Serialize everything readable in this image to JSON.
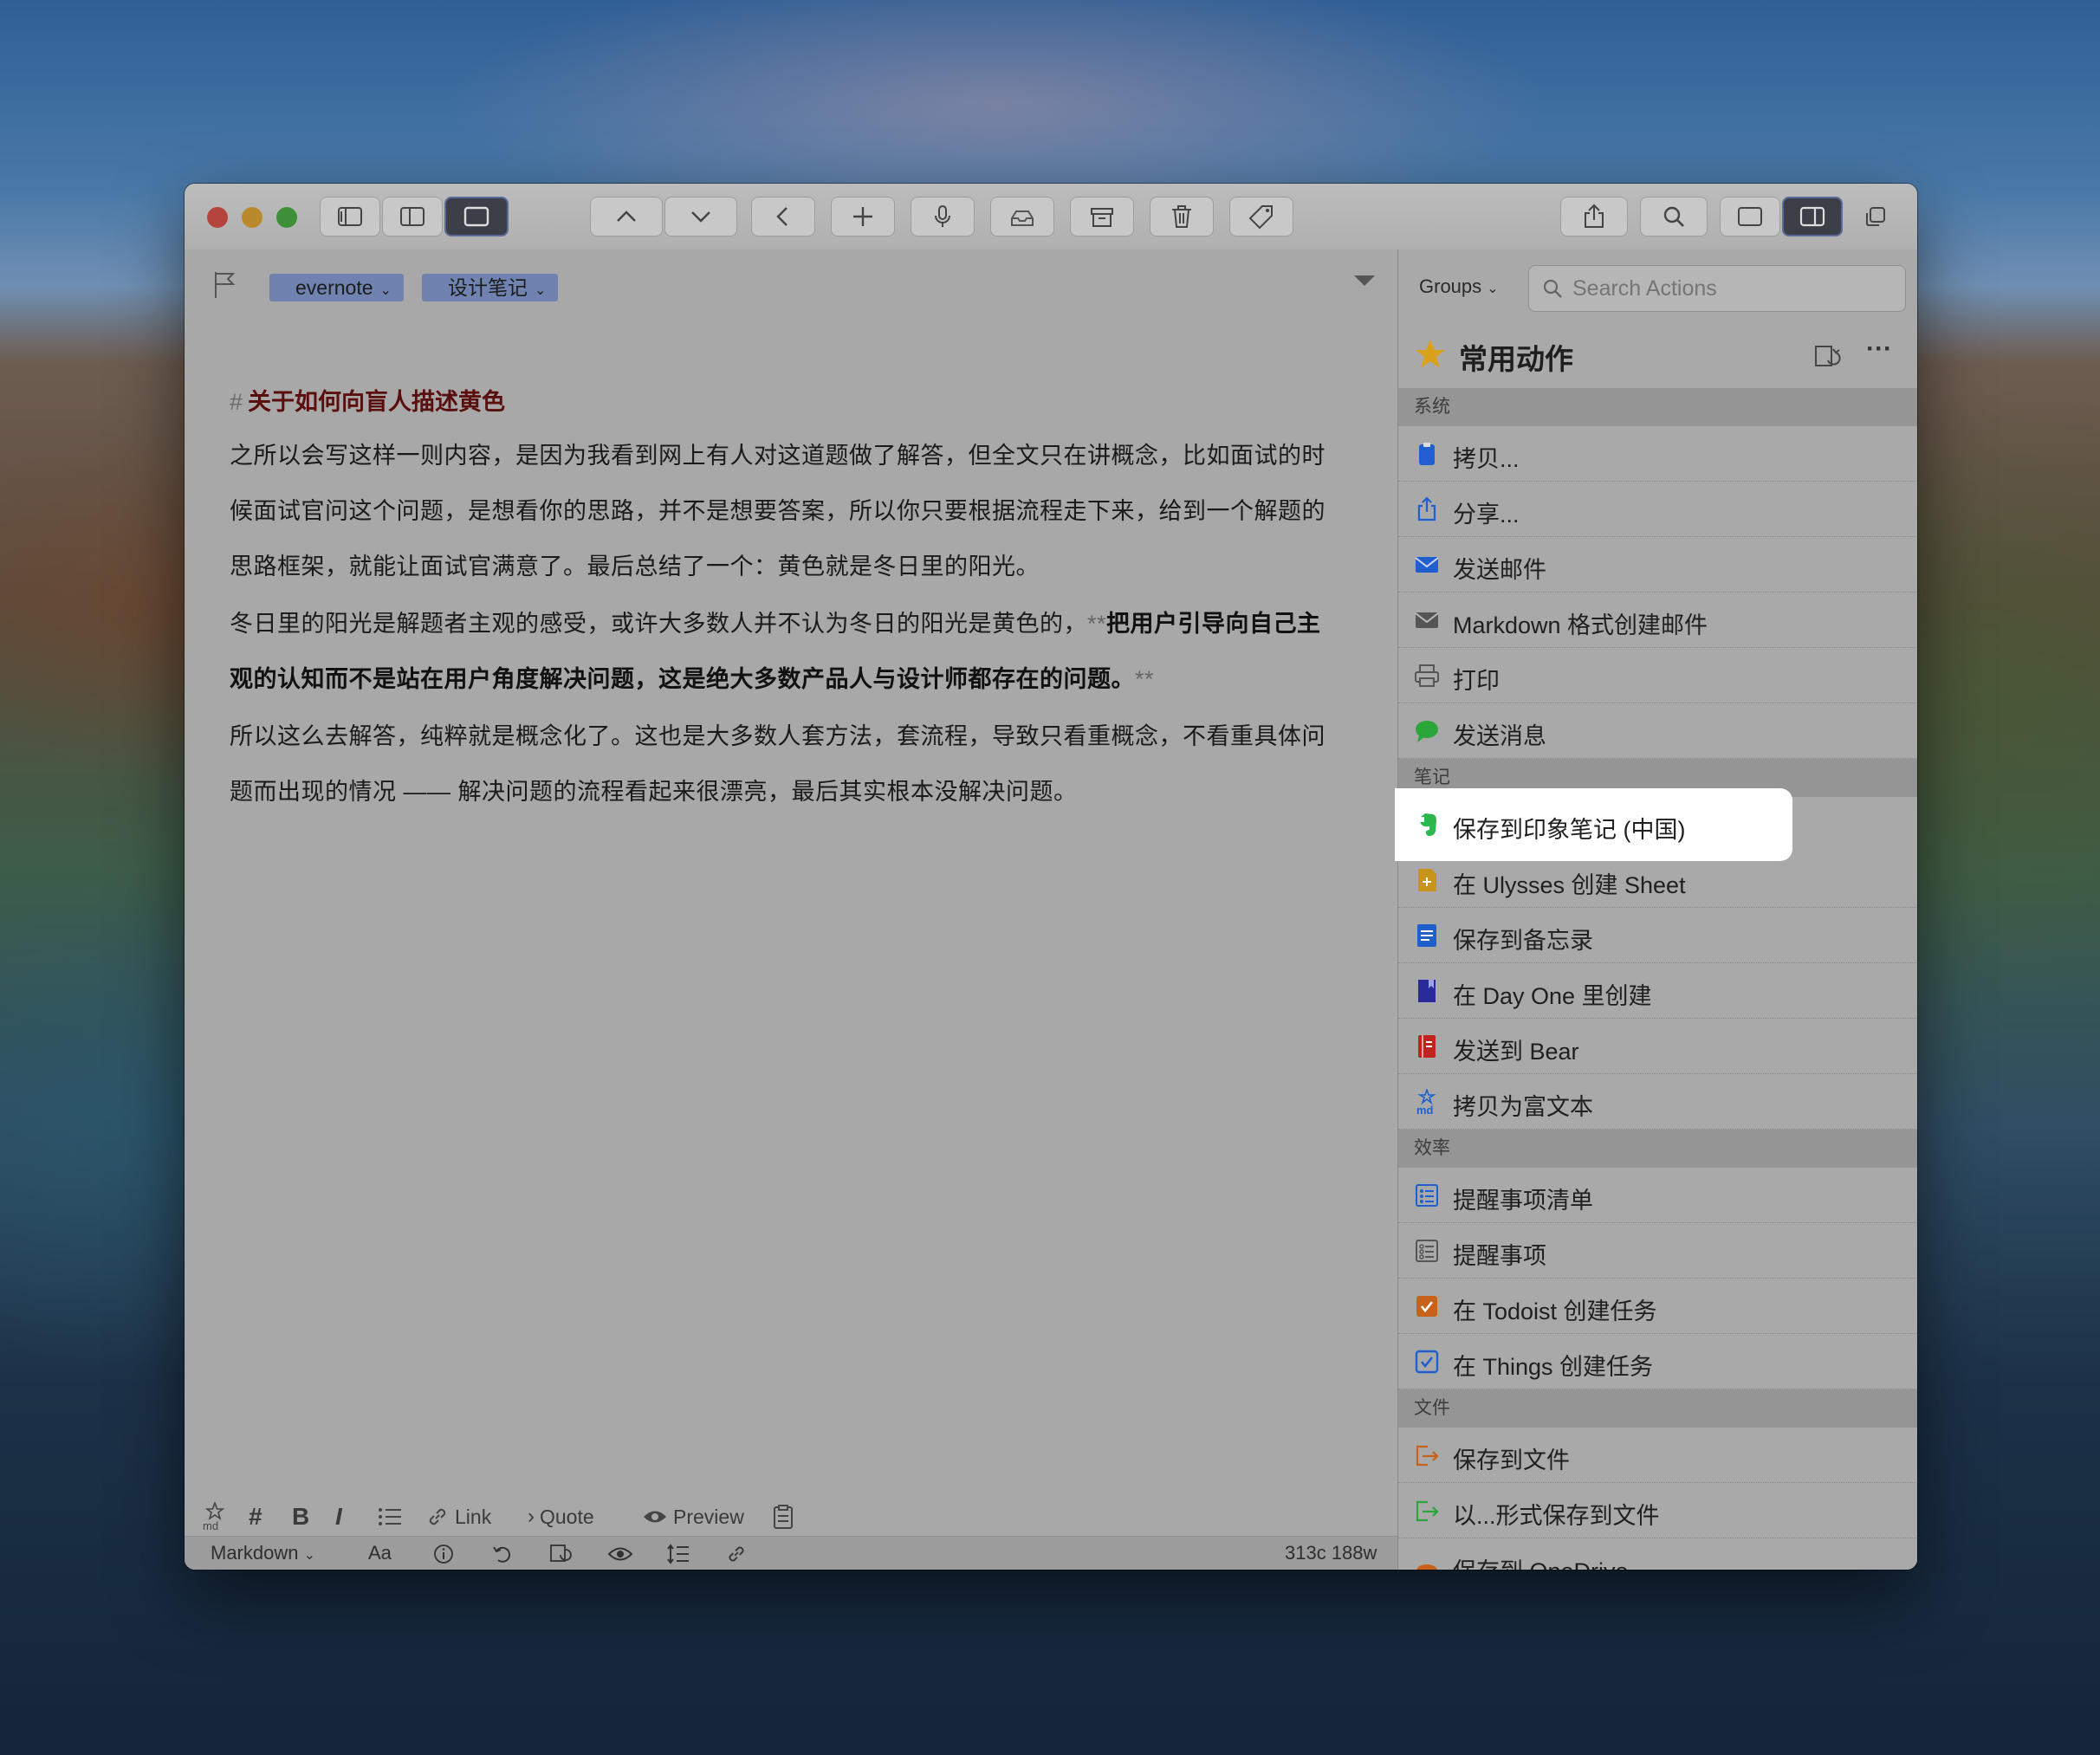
{
  "editor": {
    "tags": [
      "evernote",
      "设计笔记"
    ],
    "heading_mark": "#",
    "heading": "关于如何向盲人描述黄色",
    "para1_line1": "之所以会写这样一则内容，是因为我看到网上有人对这道题做了解答，但全文只在讲概念，比如面试的时",
    "para1_line2": "候面试官问这个问题，是想看你的思路，并不是想要答案，所以你只要根据流程走下来，给到一个解题的",
    "para1_line3": "思路框架，就能让面试官满意了。最后总结了一个：黄色就是冬日里的阳光。",
    "para2_line1_plain": "冬日里的阳光是解题者主观的感受，或许大多数人并不认为冬日的阳光是黄色的，",
    "para2_mark_open": "**",
    "para2_line1_bold": "把用户引导向自己主",
    "para2_line2_bold": "观的认知而不是站在用户角度解决问题，这是绝大多数产品人与设计师都存在的问题。",
    "para2_mark_close": "**",
    "para3_line1": "所以这么去解答，纯粹就是概念化了。这也是大多数人套方法，套流程，导致只看重概念，不看重具体问",
    "para3_line2": "题而出现的情况 —— 解决问题的流程看起来很漂亮，最后其实根本没解决问题。"
  },
  "format_bar": {
    "link": "Link",
    "quote": "Quote",
    "preview": "Preview"
  },
  "status_bar": {
    "mode": "Markdown",
    "font_size": "Aa",
    "count": "313c 188w"
  },
  "panel": {
    "groups_label": "Groups",
    "search_placeholder": "Search Actions",
    "title": "常用动作",
    "sections": [
      {
        "name": "系统",
        "items": [
          {
            "label": "拷贝...",
            "icon": "clipboard-icon",
            "color": "#1f5fd0"
          },
          {
            "label": "分享...",
            "icon": "share-icon",
            "color": "#1f5fd0"
          },
          {
            "label": "发送邮件",
            "icon": "mail-icon",
            "color": "#1f5fd0"
          },
          {
            "label": "Markdown 格式创建邮件",
            "icon": "mail-gray-icon",
            "color": "#555555"
          },
          {
            "label": "打印",
            "icon": "printer-icon",
            "color": "#555555"
          },
          {
            "label": "发送消息",
            "icon": "message-icon",
            "color": "#2aa63a"
          }
        ]
      },
      {
        "name": "笔记",
        "items": [
          {
            "label": "保存到印象笔记 (中国)",
            "icon": "evernote-icon",
            "color": "#2db84d"
          },
          {
            "label": "在 Ulysses 创建 Sheet",
            "icon": "ulysses-icon",
            "color": "#c8941a"
          },
          {
            "label": "保存到备忘录",
            "icon": "notes-icon",
            "color": "#1f5fd0"
          },
          {
            "label": "在 Day One 里创建",
            "icon": "dayone-icon",
            "color": "#2a2a9a"
          },
          {
            "label": "发送到 Bear",
            "icon": "bear-icon",
            "color": "#c0241f"
          },
          {
            "label": "拷贝为富文本",
            "icon": "markdown-icon",
            "color": "#1f5fd0"
          }
        ]
      },
      {
        "name": "效率",
        "items": [
          {
            "label": "提醒事项清单",
            "icon": "reminders-list-icon",
            "color": "#1f5fd0"
          },
          {
            "label": "提醒事项",
            "icon": "reminders-icon",
            "color": "#555555"
          },
          {
            "label": "在 Todoist 创建任务",
            "icon": "todoist-icon",
            "color": "#c8621a"
          },
          {
            "label": "在 Things 创建任务",
            "icon": "things-icon",
            "color": "#1f5fd0"
          }
        ]
      },
      {
        "name": "文件",
        "items": [
          {
            "label": "保存到文件",
            "icon": "file-export-icon",
            "color": "#c8621a"
          },
          {
            "label": "以...形式保存到文件",
            "icon": "file-export-green-icon",
            "color": "#2aa63a"
          },
          {
            "label": "保存到 OneDrive",
            "icon": "onedrive-icon",
            "color": "#c8621a"
          }
        ]
      }
    ]
  },
  "colors": {
    "accent": "#1f5fd0",
    "highlight": "#ffffff",
    "heading": "#5a0e0e"
  }
}
